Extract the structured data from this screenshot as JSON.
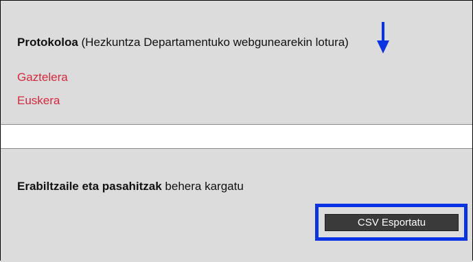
{
  "protocol_section": {
    "title_bold": "Protokoloa",
    "title_rest": " (Hezkuntza Departamentuko webgunearekin lotura)",
    "links": [
      {
        "label": "Gaztelera"
      },
      {
        "label": "Euskera"
      }
    ]
  },
  "download_section": {
    "title_bold": "Erabiltzaile eta pasahitzak",
    "title_rest": " behera kargatu",
    "export_button_label": "CSV Esportatu"
  },
  "annotation": {
    "highlight_color": "#0b33e6",
    "arrow_icon": "arrow-down-icon"
  },
  "colors": {
    "panel_bg": "#dcdcdc",
    "link": "#d8283d",
    "button_bg": "#3a3a3a"
  }
}
